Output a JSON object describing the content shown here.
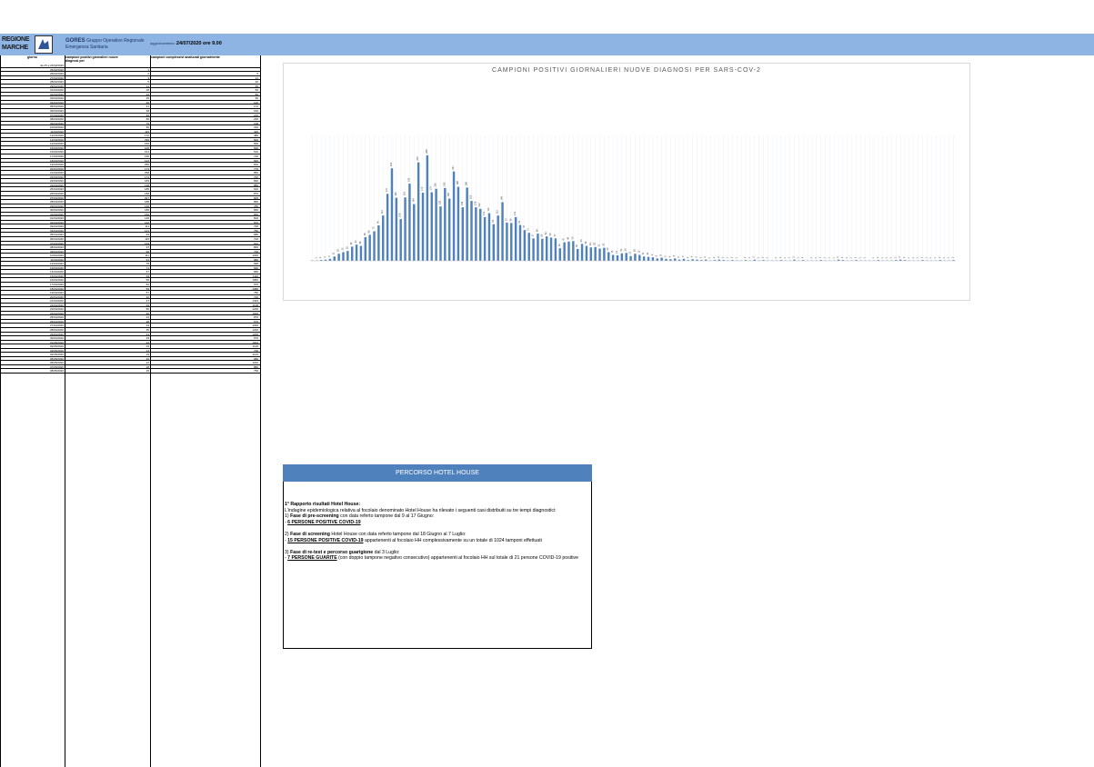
{
  "header": {
    "logo_line1": "REGIONE",
    "logo_line2": "MARCHE",
    "org_name": "GORES",
    "org_desc1": "Gruppo Operativo Regionale",
    "org_desc2": "Emergenza Sanitaria",
    "update_label": "aggiornamento:",
    "update_value": "24/07/2020 ore 9.00"
  },
  "table": {
    "col_giorno": "giorno",
    "col_positivi": "campioni positivi giornalieri nuove diagnosi per",
    "col_campioni": "campioni complessivi analizzati giornalmente",
    "rows": [
      {
        "d": "da 26 a 24/02/2020",
        "p": "",
        "c": ""
      },
      {
        "d": "25/02/2020",
        "p": "1",
        "c": ""
      },
      {
        "d": "26/02/2020",
        "p": "2",
        "c": "5"
      },
      {
        "d": "27/02/2020",
        "p": "3",
        "c": "12"
      },
      {
        "d": "28/02/2020",
        "p": "5",
        "c": "20"
      },
      {
        "d": "29/02/2020",
        "p": "11",
        "c": "35"
      },
      {
        "d": "01/03/2020",
        "p": "18",
        "c": "56"
      },
      {
        "d": "02/03/2020",
        "p": "22",
        "c": "80"
      },
      {
        "d": "03/03/2020",
        "p": "25",
        "c": "96"
      },
      {
        "d": "04/03/2020",
        "p": "36",
        "c": "120"
      },
      {
        "d": "05/03/2020",
        "p": "41",
        "c": "172"
      },
      {
        "d": "06/03/2020",
        "p": "38",
        "c": "160"
      },
      {
        "d": "07/03/2020",
        "p": "60",
        "c": "210"
      },
      {
        "d": "08/03/2020",
        "p": "66",
        "c": "230"
      },
      {
        "d": "09/03/2020",
        "p": "75",
        "c": "198"
      },
      {
        "d": "10/03/2020",
        "p": "90",
        "c": "310"
      },
      {
        "d": "11/03/2020",
        "p": "115",
        "c": "420"
      },
      {
        "d": "12/03/2020",
        "p": "170",
        "c": "480"
      },
      {
        "d": "13/03/2020",
        "p": "235",
        "c": "560"
      },
      {
        "d": "14/03/2020",
        "p": "160",
        "c": "590"
      },
      {
        "d": "15/03/2020",
        "p": "106",
        "c": "530"
      },
      {
        "d": "16/03/2020",
        "p": "161",
        "c": "610"
      },
      {
        "d": "17/03/2020",
        "p": "196",
        "c": "720"
      },
      {
        "d": "18/03/2020",
        "p": "144",
        "c": "690"
      },
      {
        "d": "19/03/2020",
        "p": "250",
        "c": "810"
      },
      {
        "d": "20/03/2020",
        "p": "173",
        "c": "770"
      },
      {
        "d": "21/03/2020",
        "p": "268",
        "c": "850"
      },
      {
        "d": "22/03/2020",
        "p": "174",
        "c": "760"
      },
      {
        "d": "23/03/2020",
        "p": "183",
        "c": "830"
      },
      {
        "d": "24/03/2020",
        "p": "138",
        "c": "880"
      },
      {
        "d": "25/03/2020",
        "p": "185",
        "c": "910"
      },
      {
        "d": "26/03/2020",
        "p": "158",
        "c": "870"
      },
      {
        "d": "27/03/2020",
        "p": "227",
        "c": "925"
      },
      {
        "d": "28/03/2020",
        "p": "188",
        "c": "890"
      },
      {
        "d": "29/03/2020",
        "p": "136",
        "c": "780"
      },
      {
        "d": "30/03/2020",
        "p": "186",
        "c": "830"
      },
      {
        "d": "31/03/2020",
        "p": "152",
        "c": "900"
      },
      {
        "d": "01/04/2020",
        "p": "136",
        "c": "820"
      },
      {
        "d": "02/04/2020",
        "p": "132",
        "c": "870"
      },
      {
        "d": "03/04/2020",
        "p": "111",
        "c": "795"
      },
      {
        "d": "04/04/2020",
        "p": "121",
        "c": "750"
      },
      {
        "d": "05/04/2020",
        "p": "93",
        "c": "680"
      },
      {
        "d": "06/04/2020",
        "p": "115",
        "c": "720"
      },
      {
        "d": "07/04/2020",
        "p": "149",
        "c": "912"
      },
      {
        "d": "08/04/2020",
        "p": "97",
        "c": "860"
      },
      {
        "d": "09/04/2020",
        "p": "96",
        "c": "790"
      },
      {
        "d": "10/04/2020",
        "p": "111",
        "c": "1026"
      },
      {
        "d": "11/04/2020",
        "p": "91",
        "c": "980"
      },
      {
        "d": "12/04/2020",
        "p": "78",
        "c": "698"
      },
      {
        "d": "13/04/2020",
        "p": "71",
        "c": "640"
      },
      {
        "d": "14/04/2020",
        "p": "57",
        "c": "680"
      },
      {
        "d": "15/04/2020",
        "p": "69",
        "c": "1110"
      },
      {
        "d": "16/04/2020",
        "p": "56",
        "c": "1052"
      },
      {
        "d": "17/04/2020",
        "p": "62",
        "c": "970"
      },
      {
        "d": "18/04/2020",
        "p": "59",
        "c": "1080"
      },
      {
        "d": "19/04/2020",
        "p": "57",
        "c": "780"
      },
      {
        "d": "20/04/2020",
        "p": "32",
        "c": "720"
      },
      {
        "d": "21/04/2020",
        "p": "47",
        "c": "1433"
      },
      {
        "d": "22/04/2020",
        "p": "49",
        "c": "1128"
      },
      {
        "d": "23/04/2020",
        "p": "50",
        "c": "1220"
      },
      {
        "d": "24/04/2020",
        "p": "30",
        "c": "1000"
      },
      {
        "d": "25/04/2020",
        "p": "43",
        "c": "870"
      },
      {
        "d": "26/04/2020",
        "p": "38",
        "c": "570"
      },
      {
        "d": "27/04/2020",
        "p": "34",
        "c": "1020"
      },
      {
        "d": "28/04/2020",
        "p": "35",
        "c": "1232"
      },
      {
        "d": "29/04/2020",
        "p": "31",
        "c": "1200"
      },
      {
        "d": "30/04/2020",
        "p": "33",
        "c": "970"
      },
      {
        "d": "01/05/2020",
        "p": "22",
        "c": "1004"
      },
      {
        "d": "02/05/2020",
        "p": "15",
        "c": "1125"
      },
      {
        "d": "03/05/2020",
        "p": "14",
        "c": "736"
      },
      {
        "d": "04/05/2020",
        "p": "19",
        "c": "1123"
      },
      {
        "d": "05/05/2020",
        "p": "20",
        "c": "986"
      },
      {
        "d": "06/05/2020",
        "p": "12",
        "c": "1010"
      },
      {
        "d": "07/05/2020",
        "p": "18",
        "c": "886"
      },
      {
        "d": "08/05/2020",
        "p": "15",
        "c": "756"
      }
    ]
  },
  "chart_data": {
    "type": "bar",
    "title": "CAMPIONI POSITIVI GIORNALIERI NUOVE DIAGNOSI PER SARS-COV-2",
    "xlabel": "",
    "ylabel": "",
    "ylim": [
      0,
      300
    ],
    "grid": false,
    "values": [
      0,
      1,
      2,
      3,
      5,
      11,
      18,
      22,
      25,
      36,
      41,
      38,
      60,
      66,
      75,
      90,
      115,
      170,
      235,
      160,
      106,
      161,
      196,
      144,
      250,
      173,
      268,
      174,
      183,
      138,
      185,
      158,
      227,
      188,
      136,
      186,
      152,
      136,
      132,
      111,
      121,
      93,
      115,
      149,
      97,
      96,
      111,
      91,
      78,
      71,
      57,
      69,
      56,
      62,
      59,
      57,
      32,
      47,
      49,
      50,
      30,
      43,
      38,
      34,
      35,
      31,
      33,
      22,
      15,
      14,
      19,
      20,
      12,
      18,
      15,
      11,
      10,
      9,
      6,
      8,
      5,
      4,
      6,
      3,
      5,
      2,
      4,
      3,
      2,
      3,
      1,
      2,
      3,
      2,
      1,
      2,
      1,
      0,
      2,
      1,
      3,
      1,
      2,
      1,
      0,
      1,
      2,
      1,
      1,
      3,
      1,
      2,
      0,
      1,
      1,
      2,
      1,
      1,
      1,
      3,
      2,
      1,
      1,
      2,
      1,
      1,
      0,
      1,
      2,
      1,
      1,
      1,
      2,
      3,
      2,
      1,
      1,
      1,
      2,
      1,
      1,
      1,
      2,
      1,
      1,
      2
    ]
  },
  "hotel_house": {
    "title": "PERCORSO HOTEL HOUSE",
    "heading": "1° Rapporto  risultati Hotel House:",
    "intro": "L'indagine epidemiologica relativa al focolaio denominato Hotel House ha rilevato i seguenti casi distribuiti su tre tempi diagnostici:",
    "p1_num": "1) ",
    "p1_bold": "Fase di pre-screening",
    "p1_rest": " con data referto tampone dal 9 al 17 Giugno:",
    "p1_line": "- ",
    "p1_u": "6 PERSONE POSITIVE COVID-19",
    "p2_num": "2) ",
    "p2_bold": "Fase di screening",
    "p2_rest": " Hotel House con data referto tampone dal 18 Giugno al 7 Luglio:",
    "p2_line": "- ",
    "p2_u": "15 PERSONE POSITIVE COVID-19",
    "p2_tail": " appartenenti al focolaio HH complessivamente su un totale di 1024 tamponi effettuati",
    "p3_num": "3) ",
    "p3_bold": "Fase di re-test e percorso guarigione",
    "p3_rest": " dal 3 Luglio:",
    "p3_line": "- ",
    "p3_u": "7 PERSONE GUARITE",
    "p3_tail": " (con doppio tampone negativo consecutivo) appartenenti al focolaio HH sul totale di 21 persone COVID-19 positive"
  },
  "colors": {
    "header_bg": "#8eb4e3",
    "bar": "#4f81bd",
    "panel_title_bg": "#4f81bd"
  }
}
